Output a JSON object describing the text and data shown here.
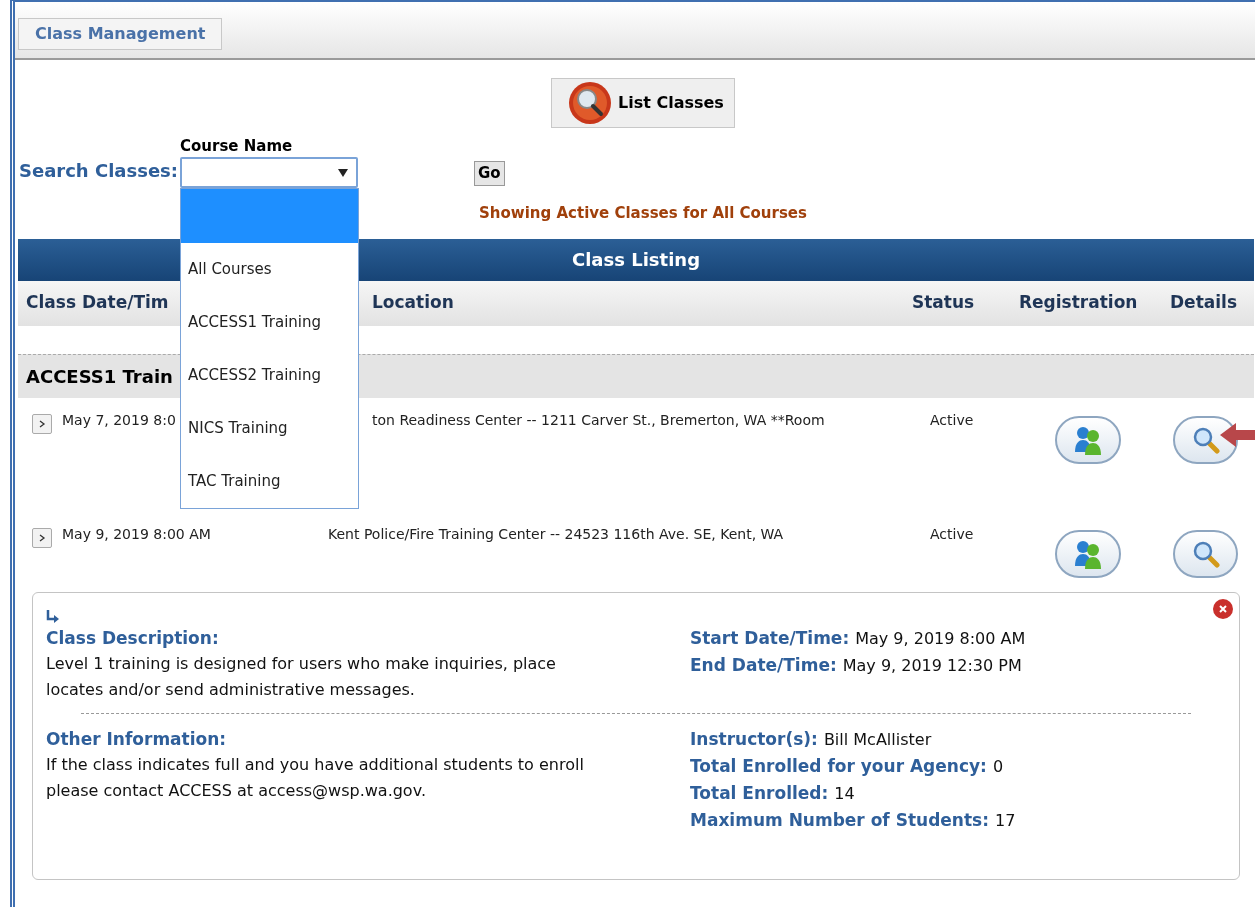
{
  "tab": {
    "label": "Class Management",
    "selected": true
  },
  "list_button": "List Classes",
  "search": {
    "label": "Search Classes:",
    "course_select": {
      "label": "Course Name",
      "expanded": true,
      "options": [
        {
          "selected": true
        },
        {
          "label": "All Courses",
          "selected": false
        },
        {
          "label": "ACCESS1 Training",
          "selected": false
        },
        {
          "label": "ACCESS2 Training",
          "selected": false
        },
        {
          "label": "NICS Training",
          "selected": false
        },
        {
          "label": "TAC Training",
          "selected": false
        }
      ]
    },
    "go_button": "Go"
  },
  "filter_message": "Showing Active Classes for All Courses",
  "table": {
    "title": "Class Listing",
    "columns": [
      "Class Date/Tim",
      "Location",
      "Status",
      "Registration",
      "Details"
    ],
    "groups": [
      {
        "title": "ACCESS1 Train",
        "rows": [
          {
            "date": "May 7, 2019 8:0",
            "location": "ton Readiness Center -- 1211 Carver St., Bremerton, WA **Room",
            "status": "Active"
          },
          {
            "date": "May 9, 2019 8:00 AM",
            "location": "Kent Police/Fire Training Center -- 24523 116th Ave. SE, Kent, WA",
            "status": "Active",
            "details": {
              "groups": [
                {
                  "heading": "Class Description:",
                  "text": "Level 1 training is designed for users who make inquiries, place locates and/or send administrative messages.",
                  "fields": [
                    {
                      "label": "Start Date/Time:",
                      "value": "May 9, 2019 8:00 AM"
                    },
                    {
                      "label": "End Date/Time:",
                      "value": "May 9, 2019 12:30 PM"
                    }
                  ]
                },
                {
                  "heading": "Other Information:",
                  "text": "If the class indicates full and you have additional students to enroll please contact ACCESS at access@wsp.wa.gov.",
                  "fields": [
                    {
                      "label": "Instructor(s):",
                      "value": "Bill McAllister"
                    },
                    {
                      "label": "Total Enrolled for your Agency:",
                      "value": "0"
                    },
                    {
                      "label": "Total Enrolled:",
                      "value": "14"
                    },
                    {
                      "label": "Maximum Number of Students:",
                      "value": "17"
                    }
                  ]
                }
              ]
            }
          }
        ]
      }
    ]
  }
}
